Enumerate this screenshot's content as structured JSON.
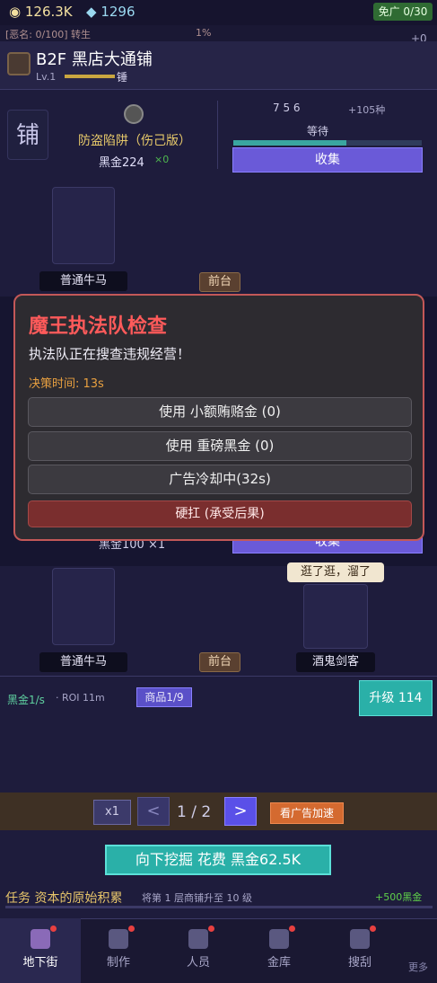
{
  "topbar": {
    "coins": "126.3K",
    "gems": "1296",
    "no_ads": "免广 0/30",
    "notice": "[恶名: 0/100]  转生",
    "notice_percent": "1%",
    "plus": "+0"
  },
  "header": {
    "floor_title": "B2F  黑店大通铺",
    "level": "Lv.1",
    "level_tag": "锤"
  },
  "shop1": {
    "icon_char": "铺",
    "trap_name": "防盗陷阱（伤己版）",
    "cost": "黑金224",
    "multiplier": "×0",
    "mats": "7  5  6",
    "mats_more": "+105种",
    "wait": "等待",
    "collect": "收集",
    "progress_fraction": 0.6
  },
  "workers": {
    "w1": "普通牛马",
    "desk1": "前台",
    "w3": "普通牛马",
    "desk2": "前台",
    "w4": "酒鬼剑客",
    "speech": "逛了逛，溜了"
  },
  "modal": {
    "title": "魔王执法队检查",
    "subtitle": "执法队正在搜查违规经营！",
    "timer": "决策时间: 13s",
    "buttons": [
      "使用 小额贿赂金 (0)",
      "使用 重磅黑金 (0)",
      "广告冷却中(32s)",
      "硬扛 (承受后果)"
    ]
  },
  "shop2": {
    "collect": "收集",
    "cost": "黑金100  ×1"
  },
  "stats": {
    "income": "黑金1/s",
    "roi": "·  ROI 11m",
    "goods": "商品1/9",
    "upgrade": "升级 114"
  },
  "pager": {
    "speed": "x1",
    "prev": "<",
    "page": "1 / 2",
    "next": ">",
    "ad": "看广告加速"
  },
  "dig_button": "向下挖掘  花费 黑金62.5K",
  "quest": {
    "title": "任务 资本的原始积累",
    "goal": "将第 1 层商铺升至 10 级",
    "reward": "+500黑金"
  },
  "nav": [
    "地下街",
    "制作",
    "人员",
    "金库",
    "搜刮"
  ],
  "nav_more": "更多"
}
